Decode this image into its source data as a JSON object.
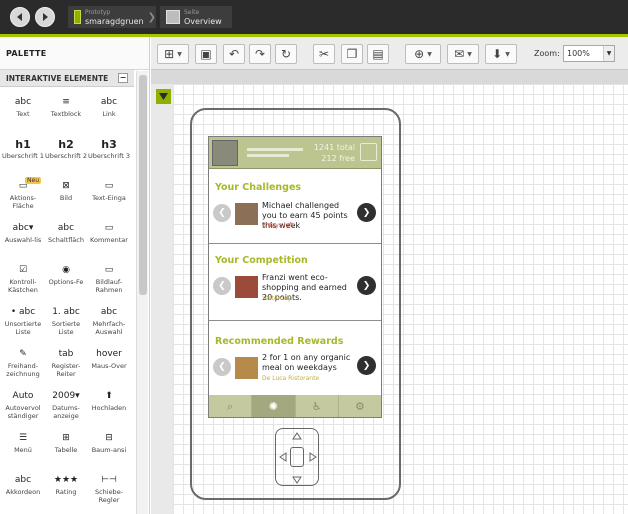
{
  "breadcrumbs": [
    {
      "small": "Prototyp",
      "label": "smaragdgruen"
    },
    {
      "small": "Seite",
      "label": "Overview"
    }
  ],
  "sidebar": {
    "title": "PALETTE",
    "section_title": "INTERAKTIVE ELEMENTE",
    "collapse_symbol": "−",
    "items": [
      {
        "icon": "abc",
        "label": "Text"
      },
      {
        "icon": "≡",
        "label": "Textblock"
      },
      {
        "icon": "abc",
        "label": "Link"
      },
      {
        "icon": "h1",
        "label": "Überschrift 1"
      },
      {
        "icon": "h2",
        "label": "Überschrift 2"
      },
      {
        "icon": "h3",
        "label": "Überschrift 3"
      },
      {
        "icon": "▭",
        "label": "Aktions-Fläche",
        "badge": "Neu"
      },
      {
        "icon": "⊠",
        "label": "Bild"
      },
      {
        "icon": "▭",
        "label": "Text-Einga"
      },
      {
        "icon": "abc▾",
        "label": "Auswahl-lis"
      },
      {
        "icon": "abc",
        "label": "Schaltfläch"
      },
      {
        "icon": "▭",
        "label": "Kommentar"
      },
      {
        "icon": "☑",
        "label": "Kontroll-Kästchen"
      },
      {
        "icon": "◉",
        "label": "Options-Fe"
      },
      {
        "icon": "▭",
        "label": "Bildlauf-Rahmen"
      },
      {
        "icon": "• abc",
        "label": "Unsortierte Liste"
      },
      {
        "icon": "1. abc",
        "label": "Sortierte Liste"
      },
      {
        "icon": "abc",
        "label": "Mehrfach-Auswahl"
      },
      {
        "icon": "✎",
        "label": "Freihand-zeichnung"
      },
      {
        "icon": "tab",
        "label": "Register-Reiter"
      },
      {
        "icon": "hover",
        "label": "Maus-Over"
      },
      {
        "icon": "Auto",
        "label": "Autovervol ständiger"
      },
      {
        "icon": "2009▾",
        "label": "Datums-anzeige"
      },
      {
        "icon": "⬆",
        "label": "Hochladen"
      },
      {
        "icon": "☰",
        "label": "Menü"
      },
      {
        "icon": "⊞",
        "label": "Tabelle"
      },
      {
        "icon": "⊟",
        "label": "Baum-ansi"
      },
      {
        "icon": "abc",
        "label": "Akkordeon"
      },
      {
        "icon": "★★★",
        "label": "Rating"
      },
      {
        "icon": "⊢⊣",
        "label": "Schiebe-Regler"
      }
    ]
  },
  "toolbar": {
    "zoom_label": "Zoom:",
    "zoom_value": "100%"
  },
  "phone": {
    "status": {
      "total": "1241 total",
      "free": "212 free"
    },
    "sections": [
      {
        "title": "Your Challenges",
        "text": "Michael challenged you to earn 45 points this week",
        "sub": "3 days left"
      },
      {
        "title": "Your Competition",
        "text": "Franzi went eco-shopping and earned 20 points.",
        "sub": "Yesterday"
      },
      {
        "title": "Recommended Rewards",
        "text": "2 for 1 on any organic meal on weekdays",
        "sub": "De Luca Ristorante"
      }
    ],
    "tabs": [
      "search-icon",
      "leaf-icon",
      "bike-icon",
      "gears-icon"
    ]
  },
  "colors": {
    "accent": "#a8c400",
    "status_bar": "#bcc48f",
    "section_title": "#a8b82a",
    "topbar": "#2b2b2b"
  }
}
